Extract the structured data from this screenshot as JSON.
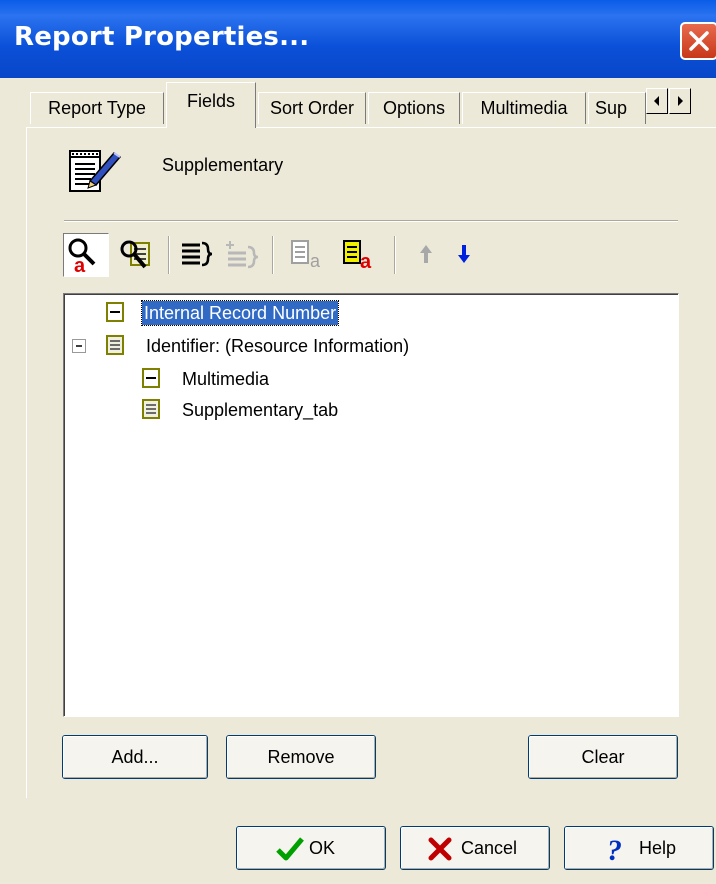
{
  "window": {
    "title": "Report Properties..."
  },
  "tabs": [
    {
      "label": "Report Type",
      "active": false
    },
    {
      "label": "Fields",
      "active": true
    },
    {
      "label": "Sort Order",
      "active": false
    },
    {
      "label": "Options",
      "active": false
    },
    {
      "label": "Multimedia",
      "active": false
    },
    {
      "label": "Sup",
      "active": false
    }
  ],
  "header": {
    "label": "Supplementary",
    "icon": "document-pencil-icon"
  },
  "toolbar": {
    "items": [
      "find-field-icon",
      "find-in-field-icon",
      "expand-text-icon",
      "collapse-text-icon",
      "add-field-icon",
      "add-field-red-icon",
      "move-up-icon",
      "move-down-icon"
    ]
  },
  "tree": {
    "nodes": [
      {
        "label": "Internal Record Number",
        "icon": "single-field-icon",
        "selected": true
      },
      {
        "label": "Identifier: (Resource Information)",
        "icon": "table-field-icon",
        "expanded": true
      },
      {
        "label": "Multimedia",
        "icon": "single-field-icon"
      },
      {
        "label": "Supplementary_tab",
        "icon": "table-field-icon"
      }
    ]
  },
  "actions": {
    "add": "Add...",
    "remove": "Remove",
    "clear": "Clear"
  },
  "footer": {
    "ok": "OK",
    "cancel": "Cancel",
    "help": "Help"
  },
  "colors": {
    "title_bar": "#0a5ce8",
    "selection": "#316ac5",
    "ok_check": "#00a000",
    "cancel_x": "#c00000",
    "help_q": "#0030c0"
  }
}
